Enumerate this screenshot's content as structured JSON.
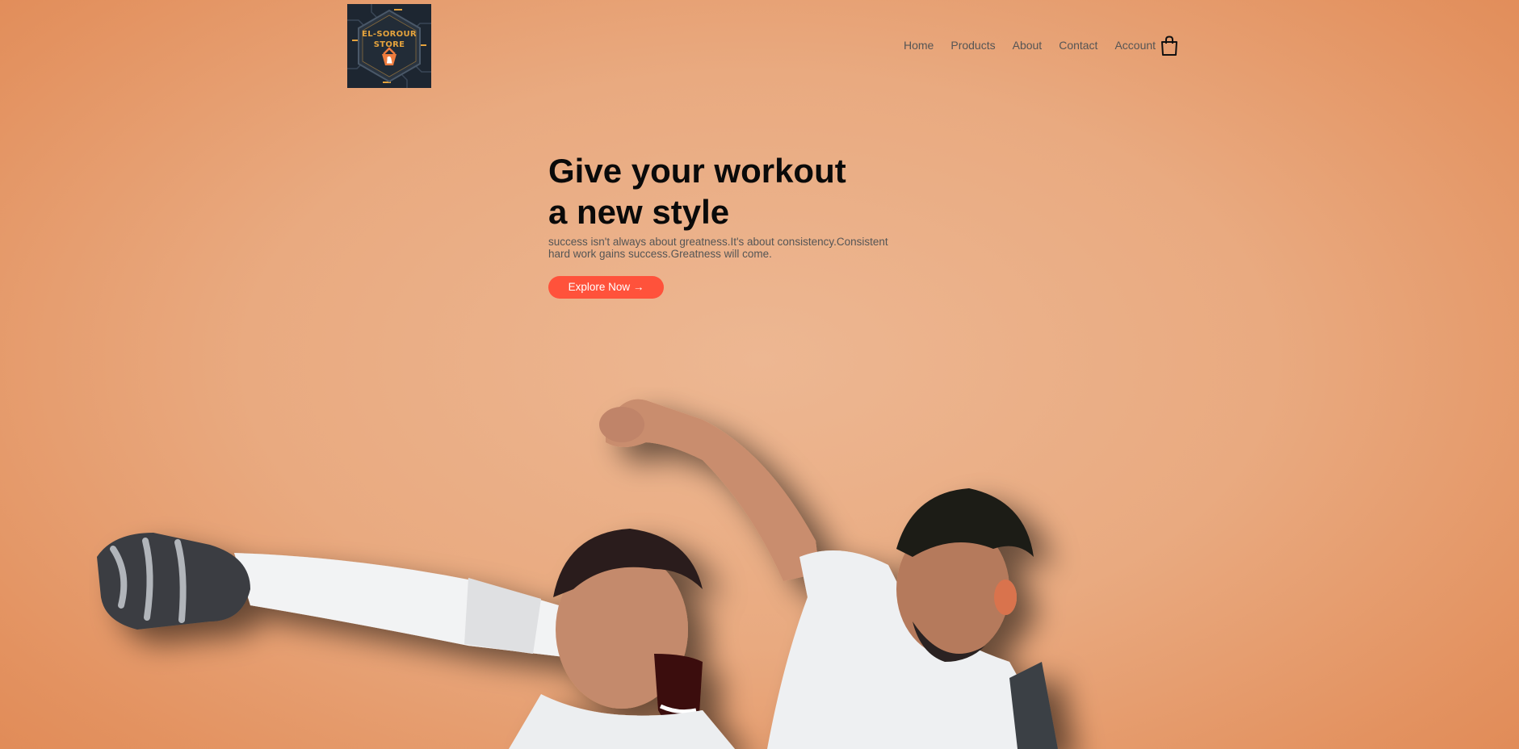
{
  "brand": {
    "logo_line1": "EL-SOROUR",
    "logo_line2": "STORE",
    "accent_color": "#e5a33d",
    "background_color": "#1d2631"
  },
  "nav": {
    "items": [
      {
        "label": "Home"
      },
      {
        "label": "Products"
      },
      {
        "label": "About"
      },
      {
        "label": "Contact"
      },
      {
        "label": "Account"
      }
    ],
    "cart_icon": "shopping-bag-icon"
  },
  "hero": {
    "title_line1": "Give your workout",
    "title_line2": "a new style",
    "subtitle": "success isn't always about greatness.It's about consistency.Consistent hard work gains success.Greatness will come.",
    "cta_label": "Explore Now →",
    "cta_color": "#ff523b",
    "image": "two-football-players-celebrating"
  }
}
